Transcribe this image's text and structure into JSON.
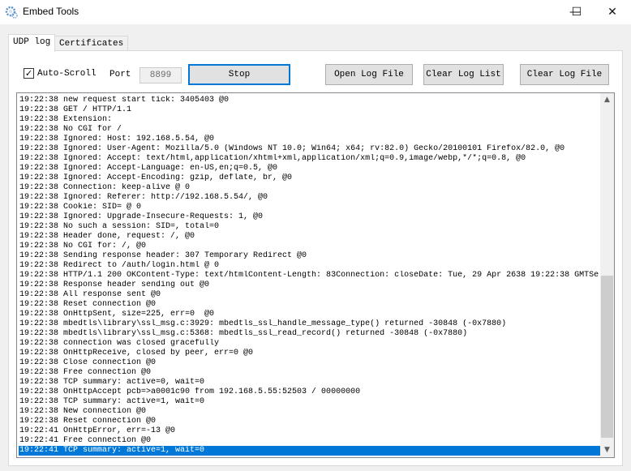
{
  "window": {
    "title": "Embed Tools",
    "minimize": "—",
    "maximize": "☐",
    "close": "✕"
  },
  "tabs": [
    {
      "label": "UDP log",
      "active": true
    },
    {
      "label": "Certificates",
      "active": false
    }
  ],
  "toolbar": {
    "auto_scroll_label": "Auto-Scroll",
    "auto_scroll_checked": true,
    "port_label": "Port",
    "port_value": "8899",
    "stop_label": "Stop",
    "open_log_label": "Open Log File",
    "clear_list_label": "Clear Log List",
    "clear_file_label": "Clear Log File"
  },
  "colors": {
    "selection": "#0078d7",
    "focus_border": "#0078d7"
  },
  "log": {
    "selected_index": 36,
    "lines": [
      "19:22:38 new request start tick: 3405403 @0",
      "19:22:38 GET / HTTP/1.1",
      "19:22:38 Extension:",
      "19:22:38 No CGI for /",
      "19:22:38 Ignored: Host: 192.168.5.54, @0",
      "19:22:38 Ignored: User-Agent: Mozilla/5.0 (Windows NT 10.0; Win64; x64; rv:82.0) Gecko/20100101 Firefox/82.0, @0",
      "19:22:38 Ignored: Accept: text/html,application/xhtml+xml,application/xml;q=0.9,image/webp,*/*;q=0.8, @0",
      "19:22:38 Ignored: Accept-Language: en-US,en;q=0.5, @0",
      "19:22:38 Ignored: Accept-Encoding: gzip, deflate, br, @0",
      "19:22:38 Connection: keep-alive @ 0",
      "19:22:38 Ignored: Referer: http://192.168.5.54/, @0",
      "19:22:38 Cookie: SID= @ 0",
      "19:22:38 Ignored: Upgrade-Insecure-Requests: 1, @0",
      "19:22:38 No such a session: SID=, total=0",
      "19:22:38 Header done, request: /, @0",
      "19:22:38 No CGI for: /, @0",
      "19:22:38 Sending response header: 307 Temporary Redirect @0",
      "19:22:38 Redirect to /auth/login.html @ 0",
      "19:22:38 HTTP/1.1 200 OKContent-Type: text/htmlContent-Length: 83Connection: closeDate: Tue, 29 Apr 2638 19:22:38 GMTSe",
      "19:22:38 Response header sending out @0",
      "19:22:38 All response sent @0",
      "19:22:38 Reset connection @0",
      "19:22:38 OnHttpSent, size=225, err=0  @0",
      "19:22:38 mbedtls\\library\\ssl_msg.c:3929: mbedtls_ssl_handle_message_type() returned -30848 (-0x7880)",
      "19:22:38 mbedtls\\library\\ssl_msg.c:5368: mbedtls_ssl_read_record() returned -30848 (-0x7880)",
      "19:22:38 connection was closed gracefully",
      "19:22:38 OnHttpReceive, closed by peer, err=0 @0",
      "19:22:38 Close connection @0",
      "19:22:38 Free connection @0",
      "19:22:38 TCP summary: active=0, wait=0",
      "19:22:38 OnHttpAccept pcb=>a0001c90 from 192.168.5.55:52503 / 00000000",
      "19:22:38 TCP summary: active=1, wait=0",
      "19:22:38 New connection @0",
      "19:22:38 Reset connection @0",
      "19:22:41 OnHttpError, err=-13 @0",
      "19:22:41 Free connection @0",
      "19:22:41 TCP summary: active=1, wait=0"
    ]
  }
}
